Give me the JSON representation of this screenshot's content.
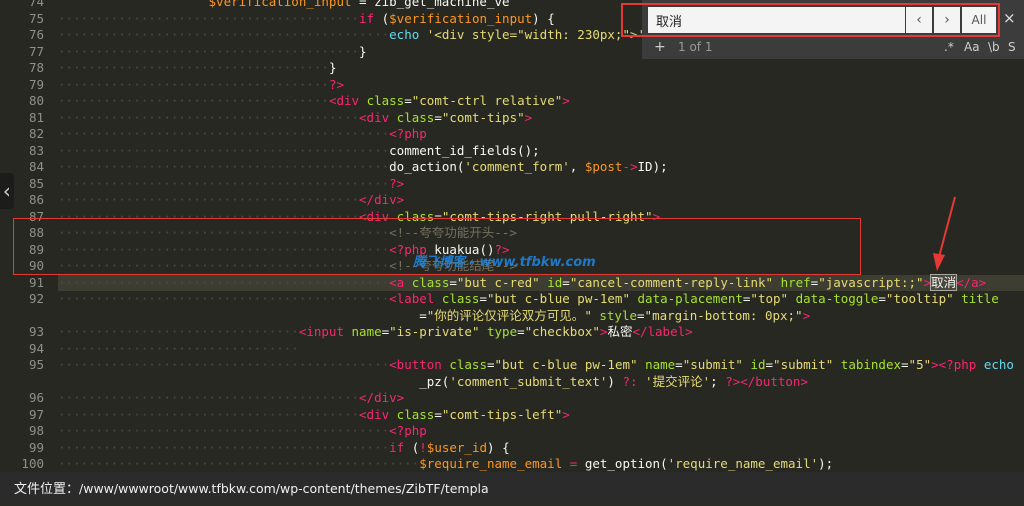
{
  "find_panel": {
    "query": "取消",
    "prev_label": "‹",
    "next_label": "›",
    "all_label": "All",
    "close_label": "×",
    "add_label": "+",
    "match_count": "1 of 1",
    "options": [
      ".*",
      "Aa",
      "\\b",
      "S"
    ]
  },
  "watermark": "腾飞博客 - www.tfbkw.com",
  "status_bar": {
    "label": "文件位置：",
    "path": "/www/wwwroot/www.tfbkw.com/wp-content/themes/ZibTF/templa"
  },
  "left_handle": "‹",
  "code_lines": [
    {
      "ln": "74",
      "html": "<span class='var'>                    $verification_input</span> = <span class='pl'>zib_get_machine_ve</span>"
    },
    {
      "ln": "75",
      "html": "<span class='ws'>········································</span><span class='kw'>if</span> (<span class='var'>$verification_input</span>) {"
    },
    {
      "ln": "76",
      "html": "<span class='ws'>············································</span><span class='fn'>echo</span> <span class='str'>'&lt;div style=\"width: 230px;\"&gt;'</span> . <span class='var'>$</span>"
    },
    {
      "ln": "77",
      "html": "<span class='ws'>········································</span>}"
    },
    {
      "ln": "78",
      "html": "<span class='ws'>····································</span>}"
    },
    {
      "ln": "79",
      "html": "<span class='ws'>····································</span><span class='tag'>?&gt;</span>"
    },
    {
      "ln": "80",
      "html": "<span class='ws'>····································</span><span class='tag'>&lt;div</span> <span class='attr'>class</span>=<span class='str'>\"comt-ctrl relative\"</span><span class='tag'>&gt;</span>"
    },
    {
      "ln": "81",
      "html": "<span class='ws'>········································</span><span class='tag'>&lt;div</span> <span class='attr'>class</span>=<span class='str'>\"comt-tips\"</span><span class='tag'>&gt;</span>"
    },
    {
      "ln": "82",
      "html": "<span class='ws'>············································</span><span class='tag'>&lt;?php</span>"
    },
    {
      "ln": "83",
      "html": "<span class='ws'>············································</span>comment_id_fields();"
    },
    {
      "ln": "84",
      "html": "<span class='ws'>············································</span>do_action(<span class='str'>'comment_form'</span>, <span class='var'>$post</span><span class='kw'>-&gt;</span>ID);"
    },
    {
      "ln": "85",
      "html": "<span class='ws'>············································</span><span class='tag'>?&gt;</span>"
    },
    {
      "ln": "86",
      "html": "<span class='ws'>········································</span><span class='tag'>&lt;/div&gt;</span>"
    },
    {
      "ln": "87",
      "html": "<span class='ws'>········································</span><span class='tag'>&lt;div</span> <span class='attr'>class</span>=<span class='str'>\"comt-tips-right pull-right\"</span><span class='tag'>&gt;</span>"
    },
    {
      "ln": "88",
      "html": "<span class='ws'>············································</span><span class='cmt'>&lt;!--<span class='chinese'>夸夸功能开头</span>--&gt;</span>"
    },
    {
      "ln": "89",
      "html": "<span class='ws'>············································</span><span class='tag'>&lt;?php</span> kuakua()<span class='tag'>?&gt;</span>"
    },
    {
      "ln": "90",
      "html": "<span class='ws'>············································</span><span class='cmt'>&lt;!--<span class='chinese'>夸夸功能结尾</span>--&gt;</span>"
    },
    {
      "ln": "91",
      "html": "<span class='ws'>············································</span><span class='tag'>&lt;a</span> <span class='attr'>class</span>=<span class='str'>\"but c-red\"</span> <span class='attr'>id</span>=<span class='str'>\"cancel-comment-reply-link\"</span> <span class='attr'>href</span>=<span class='str'>\"javascript:;\"</span><span class='tag'>&gt;</span><span class='hl chinese'>取消</span><span class='tag'>&lt;/a&gt;</span>"
    },
    {
      "ln": "92",
      "html": "<span class='ws'>············································</span><span class='tag'>&lt;label</span> <span class='attr'>class</span>=<span class='str'>\"but c-blue pw-1em\"</span> <span class='attr'>data-placement</span>=<span class='str'>\"top\"</span> <span class='attr'>data-toggle</span>=<span class='str'>\"tooltip\"</span> <span class='attr'>title</span>"
    },
    {
      "ln": "",
      "html": "<span class='ws'>                                                </span>=<span class='str'>\"<span class='chinese'>你的评论仅评论双方可见。</span>\"</span> <span class='attr'>style</span>=<span class='str'>\"margin-bottom: 0px;\"</span><span class='tag'>&gt;</span>"
    },
    {
      "ln": "93",
      "html": "<span class='ws'>································</span><span class='tag'>&lt;input</span> <span class='attr'>name</span>=<span class='str'>\"is-private\"</span> <span class='attr'>type</span>=<span class='str'>\"checkbox\"</span><span class='tag'>&gt;</span><span class='chinese'>私密</span><span class='tag'>&lt;/label&gt;</span>"
    },
    {
      "ln": "94",
      "html": "<span class='ws'>································</span>"
    },
    {
      "ln": "95",
      "html": "<span class='ws'>············································</span><span class='tag'>&lt;button</span> <span class='attr'>class</span>=<span class='str'>\"but c-blue pw-1em\"</span> <span class='attr'>name</span>=<span class='str'>\"submit\"</span> <span class='attr'>id</span>=<span class='str'>\"submit\"</span> <span class='attr'>tabindex</span>=<span class='str'>\"5\"</span><span class='tag'>&gt;&lt;?php</span> <span class='fn'>echo</span>"
    },
    {
      "ln": "",
      "html": "<span class='ws'>                                                </span>_pz(<span class='str'>'comment_submit_text'</span>) <span class='kw'>?:</span> <span class='str'>'<span class='chinese'>提交评论</span>'</span>; <span class='tag'>?&gt;&lt;/button&gt;</span>"
    },
    {
      "ln": "96",
      "html": "<span class='ws'>········································</span><span class='tag'>&lt;/div&gt;</span>"
    },
    {
      "ln": "97",
      "html": "<span class='ws'>········································</span><span class='tag'>&lt;div</span> <span class='attr'>class</span>=<span class='str'>\"comt-tips-left\"</span><span class='tag'>&gt;</span>"
    },
    {
      "ln": "98",
      "html": "<span class='ws'>············································</span><span class='tag'>&lt;?php</span>"
    },
    {
      "ln": "99",
      "html": "<span class='ws'>············································</span><span class='kw'>if</span> (<span class='kw'>!</span><span class='var'>$user_id</span>) {"
    },
    {
      "ln": "100",
      "html": "<span class='ws'>················································</span><span class='var'>$require_name_email</span> <span class='kw'>=</span> get_option(<span class='str'>'require_name_email'</span>);"
    }
  ]
}
